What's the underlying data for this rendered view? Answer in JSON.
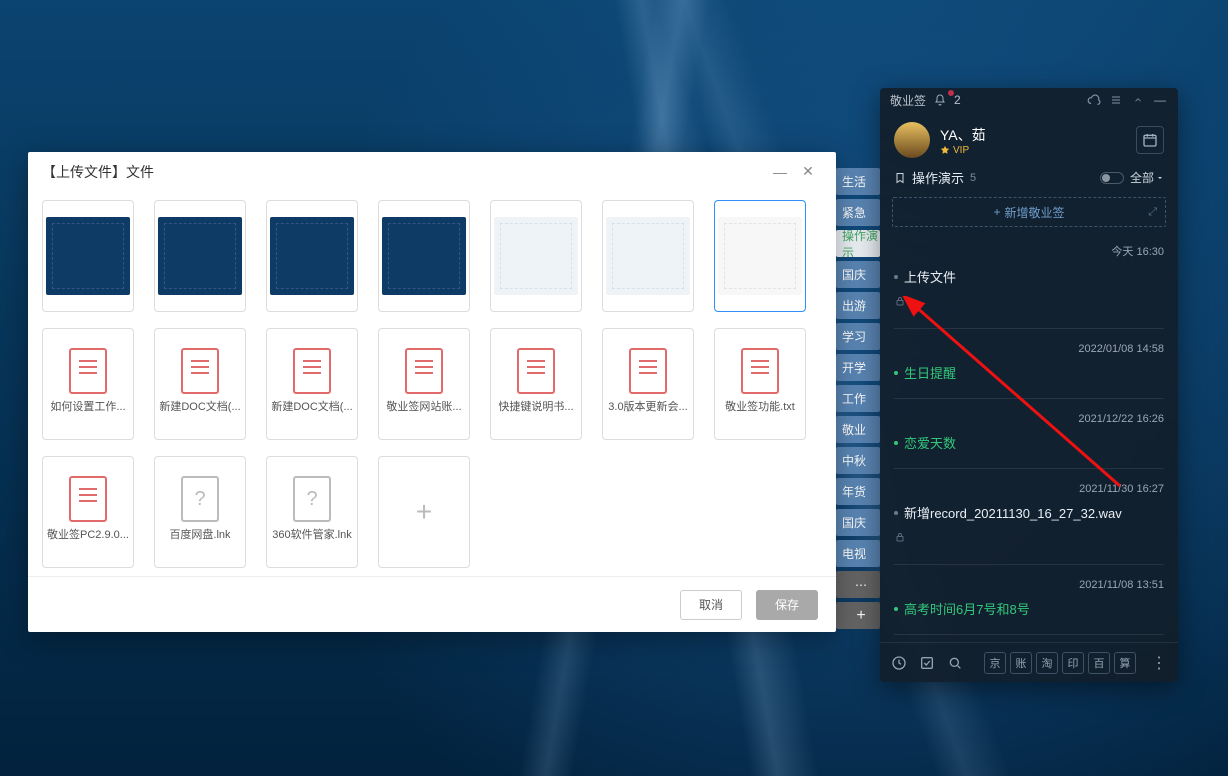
{
  "dialog": {
    "title": "【上传文件】文件",
    "cancel_label": "取消",
    "save_label": "保存",
    "files": [
      {
        "name": "",
        "type": "image",
        "variant": "dark"
      },
      {
        "name": "",
        "type": "image",
        "variant": "dark"
      },
      {
        "name": "",
        "type": "image",
        "variant": "dark"
      },
      {
        "name": "",
        "type": "image",
        "variant": "dark"
      },
      {
        "name": "",
        "type": "image",
        "variant": "light"
      },
      {
        "name": "",
        "type": "image",
        "variant": "light"
      },
      {
        "name": "",
        "type": "image",
        "variant": "white",
        "selected": true
      },
      {
        "name": "如何设置工作...",
        "type": "doc"
      },
      {
        "name": "新建DOC文档(...",
        "type": "doc"
      },
      {
        "name": "新建DOC文档(...",
        "type": "doc"
      },
      {
        "name": "敬业签网站账...",
        "type": "doc"
      },
      {
        "name": "快捷键说明书...",
        "type": "doc"
      },
      {
        "name": "3.0版本更新会...",
        "type": "doc"
      },
      {
        "name": "敬业签功能.txt",
        "type": "doc"
      },
      {
        "name": "敬业签PC2.9.0...",
        "type": "doc"
      },
      {
        "name": "百度网盘.lnk",
        "type": "unknown"
      },
      {
        "name": "360软件管家.lnk",
        "type": "unknown"
      },
      {
        "name": "",
        "type": "add"
      }
    ]
  },
  "tags": [
    {
      "label": "生活"
    },
    {
      "label": "紧急"
    },
    {
      "label": "操作演示",
      "active": true
    },
    {
      "label": "国庆"
    },
    {
      "label": "出游"
    },
    {
      "label": "学习"
    },
    {
      "label": "开学"
    },
    {
      "label": "工作"
    },
    {
      "label": "敬业"
    },
    {
      "label": "中秋"
    },
    {
      "label": "年货"
    },
    {
      "label": "国庆"
    },
    {
      "label": "电视"
    }
  ],
  "tags_more_glyph": "⋯",
  "tags_add_glyph": "+",
  "panel": {
    "app_name": "敬业签",
    "badge_count": "2",
    "user_name": "YA、茹",
    "vip_label": "VIP",
    "list_title": "操作演示",
    "list_count": "5",
    "filter_label": "全部",
    "new_label": "新增敬业签",
    "notes": [
      {
        "when": "今天 16:30",
        "title": "上传文件",
        "bullet": "grey",
        "locked": true
      },
      {
        "when": "2022/01/08 14:58",
        "title": "生日提醒",
        "bullet": "green",
        "green": true
      },
      {
        "when": "2021/12/22 16:26",
        "title": "恋爱天数",
        "bullet": "green",
        "green": true
      },
      {
        "when": "2021/11/30 16:27",
        "title": "新增record_20211130_16_27_32.wav",
        "bullet": "grey",
        "locked": true
      },
      {
        "when": "2021/11/08 13:51",
        "title": "高考时间6月7号和8号",
        "bullet": "green",
        "green": true
      }
    ],
    "bottom_chips": [
      "京",
      "账",
      "淘",
      "印",
      "百",
      "算"
    ]
  }
}
